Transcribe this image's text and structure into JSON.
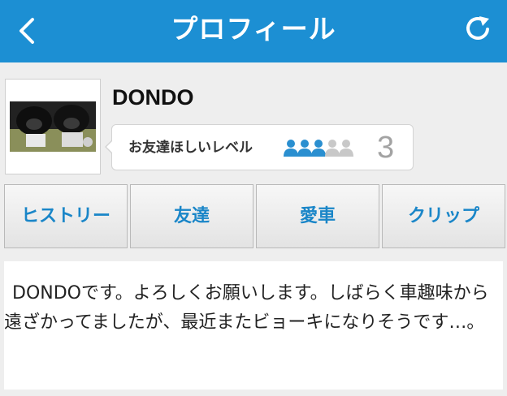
{
  "header": {
    "title": "プロフィール",
    "back_icon": "chevron-left-icon",
    "refresh_icon": "refresh-icon"
  },
  "profile": {
    "username": "DONDO",
    "level_label": "お友達ほしいレベル",
    "level_value": "3",
    "level_max": 5,
    "level_filled": 3,
    "colors": {
      "filled": "#2a8fd0",
      "empty": "#c8c8c8"
    }
  },
  "tabs": [
    {
      "label": "ヒストリー"
    },
    {
      "label": "友達"
    },
    {
      "label": "愛車"
    },
    {
      "label": "クリップ"
    }
  ],
  "bio": {
    "text": "DONDOです。よろしくお願いします。しばらく車趣味から遠ざかってましたが、最近またビョーキになりそうです…。"
  },
  "colors": {
    "accent": "#1c8fd3",
    "tab_text": "#1a86c8"
  }
}
